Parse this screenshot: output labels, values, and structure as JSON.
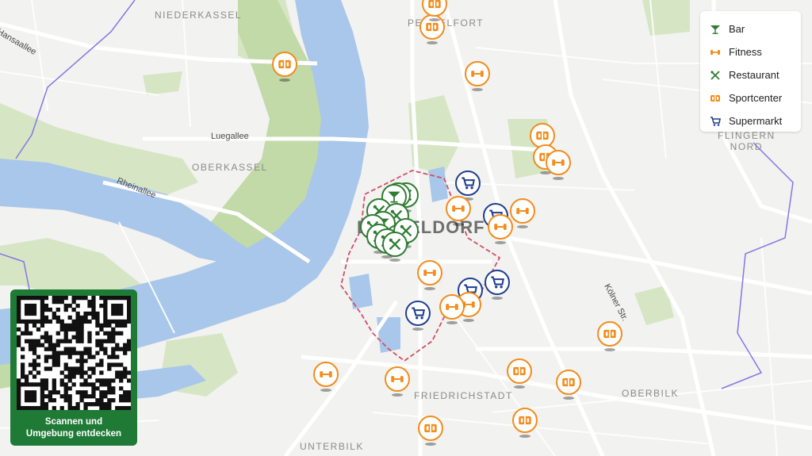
{
  "map": {
    "city_label": "DÜSSELDORF",
    "districts": [
      {
        "id": "niederkassel",
        "label": "NIEDERKASSEL"
      },
      {
        "id": "pempelfort",
        "label": "PEMPELFORT"
      },
      {
        "id": "oberkassel",
        "label": "OBERKASSEL"
      },
      {
        "id": "flingern",
        "label": "FLINGERN\nNORD"
      },
      {
        "id": "friedrichstadt",
        "label": "FRIEDRICHSTADT"
      },
      {
        "id": "oberbilk",
        "label": "OBERBILK"
      },
      {
        "id": "unterbilk",
        "label": "UNTERBILK"
      }
    ],
    "streets": [
      {
        "id": "hansaallee",
        "label": "Hansaallee"
      },
      {
        "id": "luegallee",
        "label": "Luegallee"
      },
      {
        "id": "rheinallee",
        "label": "Rheinallee"
      },
      {
        "id": "koelner",
        "label": "Kölner Str."
      }
    ]
  },
  "legend": {
    "items": [
      {
        "label": "Bar",
        "icon": "cocktail-icon",
        "color": "#2e7d32"
      },
      {
        "label": "Fitness",
        "icon": "dumbbell-icon",
        "color": "#f28c1c"
      },
      {
        "label": "Restaurant",
        "icon": "fork-knife-icon",
        "color": "#2e7d32"
      },
      {
        "label": "Sportcenter",
        "icon": "sportcenter-icon",
        "color": "#f28c1c"
      },
      {
        "label": "Supermarkt",
        "icon": "cart-icon",
        "color": "#1f3f8f"
      }
    ]
  },
  "qr": {
    "caption_line1": "Scannen und",
    "caption_line2": "Umgebung entdecken",
    "color": "#1e7a35"
  },
  "colors": {
    "water": "#a8c6e8",
    "park": "#c6dcb0",
    "road": "#ffffff",
    "fitness": "#f28c1c",
    "supermarkt": "#1f3f8f",
    "gastro": "#2e7d32",
    "boundary": "#d0506a",
    "district_line": "#7a6be0"
  }
}
